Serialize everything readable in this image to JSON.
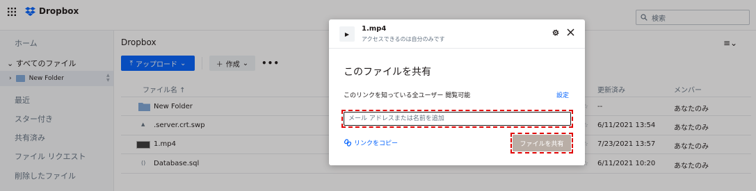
{
  "app": {
    "brand": "Dropbox",
    "accent": "#0061fe",
    "danger_outline": "#e00000"
  },
  "search": {
    "placeholder": "検索"
  },
  "sidebar": {
    "home": "ホーム",
    "all_files": "すべてのファイル",
    "tree_folder": "New Folder",
    "recent": "最近",
    "starred": "スター付き",
    "shared": "共有済み",
    "file_requests": "ファイル リクエスト",
    "deleted": "削除したファイル"
  },
  "main": {
    "breadcrumb": "Dropbox",
    "upload_label": "アップロード",
    "create_label": "作成",
    "more_label": "•••",
    "columns": {
      "name": "ファイル名 ↑",
      "modified": "更新済み",
      "members": "メンバー"
    },
    "rows": [
      {
        "name": "New Folder",
        "icon": "folder-icon",
        "modified": "--",
        "members": "あなたのみ"
      },
      {
        "name": ".server.crt.swp",
        "icon": "file-icon",
        "modified": "6/11/2021 13:54",
        "members": "あなたのみ"
      },
      {
        "name": "1.mp4",
        "icon": "video-icon",
        "modified": "7/23/2021 13:57",
        "members": "あなたのみ"
      },
      {
        "name": "Database.sql",
        "icon": "code-file-icon",
        "modified": "6/11/2021 10:20",
        "members": "あなたのみ"
      }
    ]
  },
  "modal": {
    "file_name": "1.mp4",
    "subtitle": "アクセスできるのは自分のみです",
    "title": "このファイルを共有",
    "permission_text": "このリンクを知っている全ユーザー 閲覧可能",
    "settings_label": "設定",
    "input_placeholder": "メール アドレスまたは名前を追加",
    "copy_link_label": "リンクをコピー",
    "share_button_label": "ファイルを共有"
  }
}
